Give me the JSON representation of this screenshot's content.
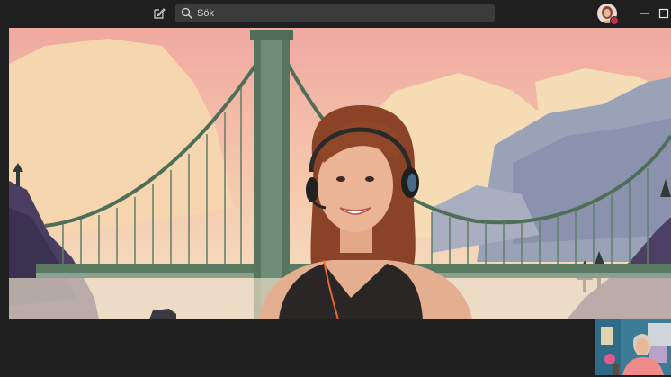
{
  "titlebar": {
    "compose_icon": "compose-icon",
    "search_icon": "search-icon",
    "search": {
      "placeholder": "Sök",
      "value": ""
    },
    "minimize_icon": "minimize-icon",
    "maximize_icon": "maximize-icon"
  },
  "colors": {
    "titlebar_bg": "#1f1f1f",
    "search_bg": "#3b3b3b",
    "presence_busy": "#c4314b",
    "sky_pink": "#f2b7a6",
    "bridge_green": "#4f6e58"
  },
  "video": {
    "background": "bridge-illustration",
    "participant": "participant-with-headset"
  }
}
